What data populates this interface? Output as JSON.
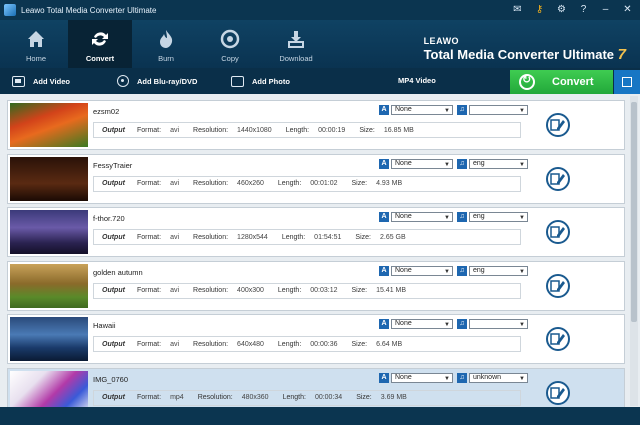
{
  "window": {
    "title": "Leawo Total Media Converter Ultimate"
  },
  "nav": [
    {
      "label": "Home",
      "icon": "home-icon",
      "active": false
    },
    {
      "label": "Convert",
      "icon": "convert-icon",
      "active": true
    },
    {
      "label": "Burn",
      "icon": "burn-icon",
      "active": false
    },
    {
      "label": "Copy",
      "icon": "copy-icon",
      "active": false
    },
    {
      "label": "Download",
      "icon": "download-icon",
      "active": false
    }
  ],
  "brand": {
    "leawo": "LEAWO",
    "product": "Total Media Converter Ultimate",
    "version": "7"
  },
  "actions": {
    "add_video": "Add Video",
    "add_bluray": "Add Blu-ray/DVD",
    "add_photo": "Add Photo",
    "format": "MP4 Video",
    "convert": "Convert"
  },
  "labels": {
    "output": "Output",
    "format": "Format:",
    "resolution": "Resolution:",
    "length": "Length:",
    "size": "Size:"
  },
  "files": [
    {
      "name": "ezsm02",
      "format": "avi",
      "resolution": "1440x1080",
      "length": "00:00:19",
      "size": "16.85 MB",
      "subtitle": "None",
      "audio": "",
      "selected": false
    },
    {
      "name": "FessyTraier",
      "format": "avi",
      "resolution": "460x260",
      "length": "00:01:02",
      "size": "4.93 MB",
      "subtitle": "None",
      "audio": "eng",
      "selected": false
    },
    {
      "name": "f-thor.720",
      "format": "avi",
      "resolution": "1280x544",
      "length": "01:54:51",
      "size": "2.65 GB",
      "subtitle": "None",
      "audio": "eng",
      "selected": false
    },
    {
      "name": "golden autumn",
      "format": "avi",
      "resolution": "400x300",
      "length": "00:03:12",
      "size": "15.41 MB",
      "subtitle": "None",
      "audio": "eng",
      "selected": false
    },
    {
      "name": "Hawaii",
      "format": "avi",
      "resolution": "640x480",
      "length": "00:00:36",
      "size": "6.64 MB",
      "subtitle": "None",
      "audio": "",
      "selected": false
    },
    {
      "name": "IMG_0760",
      "format": "mp4",
      "resolution": "480x360",
      "length": "00:00:34",
      "size": "3.69 MB",
      "subtitle": "None",
      "audio": "unknown",
      "selected": true
    }
  ],
  "colors": {
    "accent_green": "#2fbe45",
    "toolbar": "#0f4263",
    "selected_row": "#cfe0ef"
  }
}
